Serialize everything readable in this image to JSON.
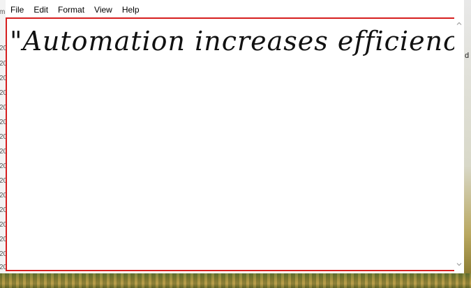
{
  "menu": {
    "file": "File",
    "edit": "Edit",
    "format": "Format",
    "view": "View",
    "help": "Help"
  },
  "editor": {
    "content": "\"Automation increases efficiency\""
  },
  "background": {
    "left_column_chars": [
      "m",
      "20",
      "20",
      "20",
      "20",
      "20",
      "20",
      "20",
      "20",
      "20",
      "20",
      "20",
      "20",
      "20",
      "20",
      "20",
      "20"
    ],
    "right_char": "d"
  },
  "icons": {
    "scroll_up": "chevron-up-icon",
    "scroll_down": "chevron-down-icon"
  },
  "colors": {
    "editor_border": "#d61f1f"
  }
}
